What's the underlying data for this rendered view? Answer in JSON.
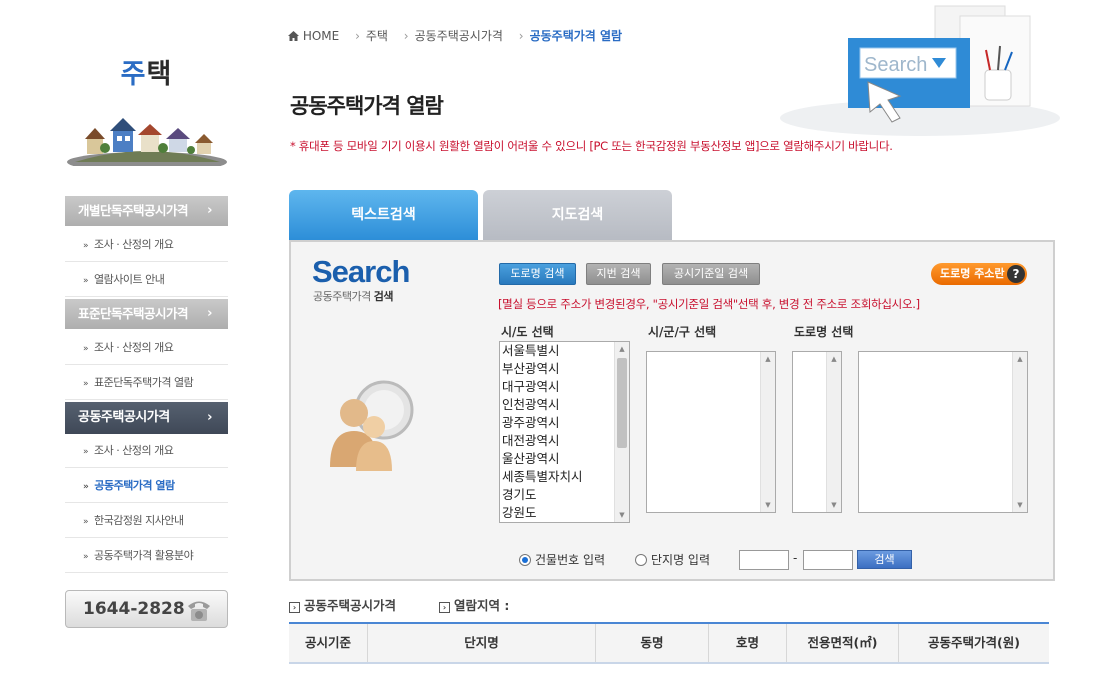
{
  "sidebar": {
    "title_first": "주",
    "title_rest": "택",
    "menus": [
      {
        "label": "개별단독주택공시가격",
        "chev": "›"
      },
      {
        "label": "표준단독주택공시가격",
        "chev": "›"
      },
      {
        "label": "공동주택공시가격",
        "chev": "›"
      }
    ],
    "subs": {
      "a1": "조사 · 산정의 개요",
      "a2": "열람사이트 안내",
      "b1": "조사 · 산정의 개요",
      "b2": "표준단독주택가격 열람",
      "c1": "조사 · 산정의 개요",
      "c2": "공동주택가격 열람",
      "c3": "한국감정원 지사안내",
      "c4": "공동주택가격 활용분야"
    },
    "bullet": "»",
    "phone": "1644-2828"
  },
  "breadcrumb": [
    "HOME",
    "주택",
    "공동주택공시가격",
    "공동주택가격 열람"
  ],
  "breadcrumb_sep": "›",
  "page_title": "공동주택가격 열람",
  "notice": "* 휴대폰 등 모바일 기기 이용시 원활한 열람이 어려울 수 있으니 [PC 또는 한국감정원 부동산정보 앱]으로 열람해주시기 바랍니다.",
  "hero": {
    "search_text": "Search"
  },
  "tabs": {
    "text": "텍스트검색",
    "map": "지도검색"
  },
  "search": {
    "logo": "Search",
    "logo_sub_plain": "공동주택가격",
    "logo_sub_bold": "검색",
    "btn_road": "도로명 검색",
    "btn_lot": "지번 검색",
    "btn_base": "공시기준일 검색",
    "help": "도로명 주소란",
    "help_q": "?",
    "guide": "[멸실 등으로 주소가 변경된경우, \"공시기준일 검색\"선택 후, 변경 전 주소로 조회하십시오.]",
    "label_sido": "시/도 선택",
    "label_sigungu": "시/군/구 선택",
    "label_doro": "도로명 선택",
    "sido_options": [
      "서울특별시",
      "부산광역시",
      "대구광역시",
      "인천광역시",
      "광주광역시",
      "대전광역시",
      "울산광역시",
      "세종특별자치시",
      "경기도",
      "강원도"
    ],
    "radio_building": "건물번호 입력",
    "radio_complex": "단지명 입력",
    "dash": "-",
    "go": "검색"
  },
  "result": {
    "section1": "공동주택공시가격",
    "section2": "열람지역 :",
    "columns": [
      "공시기준",
      "단지명",
      "동명",
      "호명",
      "전용면적(㎡)",
      "공동주택가격(원)"
    ]
  },
  "colors": {
    "accent": "#2a6cc4",
    "notice": "#c8102e",
    "tab_active": "#3d9be2",
    "help": "#f47e10"
  }
}
